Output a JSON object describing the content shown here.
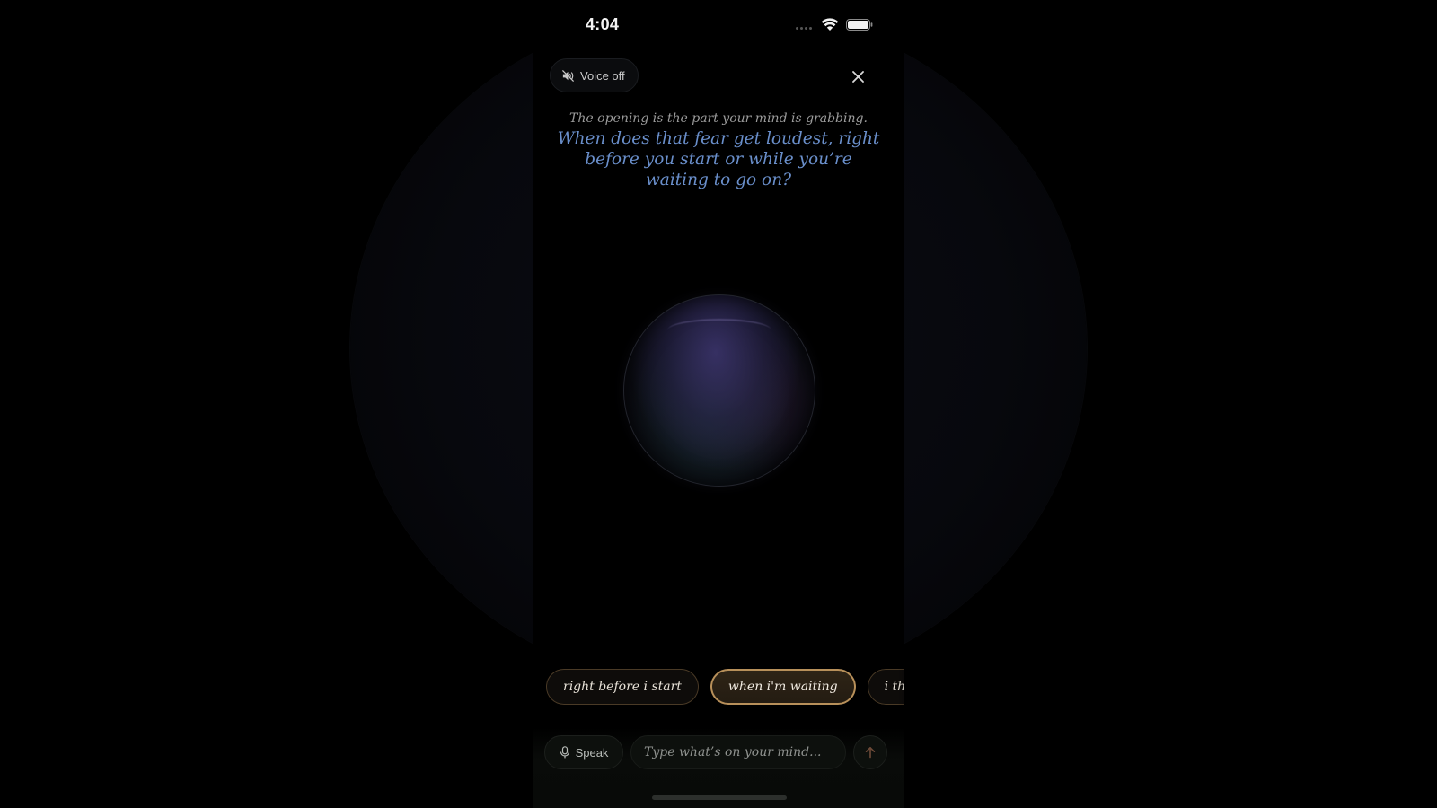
{
  "status_bar": {
    "time": "4:04",
    "icons": [
      "cellular-icon",
      "wifi-icon",
      "battery-icon"
    ]
  },
  "header": {
    "voice_toggle_label": "Voice off",
    "voice_icon": "speaker-muted-icon",
    "close_icon": "close-icon"
  },
  "prompt": {
    "intro": "The opening is the part your mind is grabbing.",
    "question": "When does that fear get loudest, right before you start or while you’re waiting to go on?"
  },
  "suggestions": [
    {
      "label": "right before i start",
      "selected": false
    },
    {
      "label": "when i'm waiting",
      "selected": true
    },
    {
      "label": "i think",
      "selected": false
    }
  ],
  "composer": {
    "speak_label": "Speak",
    "speak_icon": "microphone-icon",
    "input_value": "",
    "input_placeholder": "Type what’s on your mind...",
    "send_icon": "arrow-up-icon"
  },
  "colors": {
    "question_text": "#6a8fcb",
    "chip_selected_border": "#b8905a",
    "background": "#000000"
  }
}
